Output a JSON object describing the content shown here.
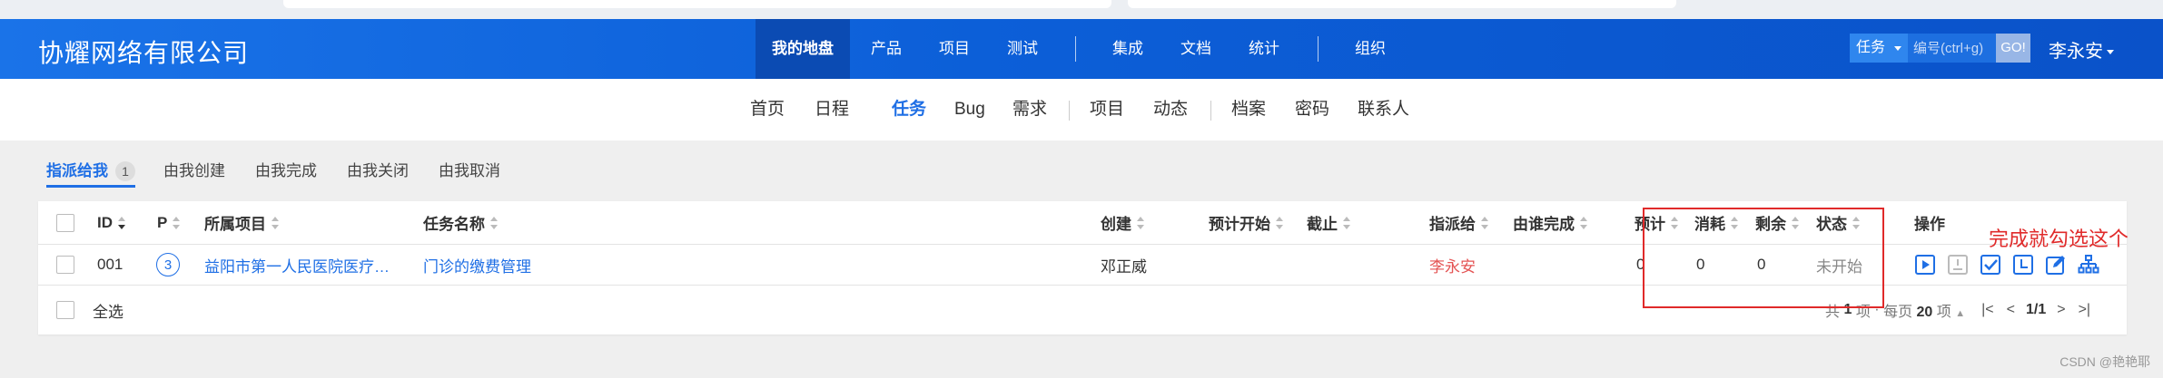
{
  "header": {
    "brand": "协耀网络有限公司",
    "nav": [
      "我的地盘",
      "产品",
      "项目",
      "测试",
      "集成",
      "文档",
      "统计",
      "组织"
    ],
    "active_nav": "我的地盘",
    "search": {
      "type_label": "任务",
      "placeholder": "编号(ctrl+g)",
      "go_label": "GO!"
    },
    "user": "李永安"
  },
  "subnav": {
    "items": [
      "首页",
      "日程",
      "任务",
      "Bug",
      "需求",
      "项目",
      "动态",
      "档案",
      "密码",
      "联系人"
    ],
    "active": "任务"
  },
  "filters": {
    "items": [
      "指派给我",
      "由我创建",
      "由我完成",
      "由我关闭",
      "由我取消"
    ],
    "active": "指派给我",
    "active_count": "1"
  },
  "table": {
    "headers": {
      "id": "ID",
      "pri": "P",
      "project": "所属项目",
      "name": "任务名称",
      "creator": "创建",
      "est_start": "预计开始",
      "deadline": "截止",
      "assigned": "指派给",
      "finished_by": "由谁完成",
      "estimate": "预计",
      "consumed": "消耗",
      "left": "剩余",
      "status": "状态",
      "actions": "操作"
    },
    "rows": [
      {
        "id": "001",
        "pri": "3",
        "project": "益阳市第一人民医院医疗…",
        "name": "门诊的缴费管理",
        "creator": "邓正威",
        "est_start": "",
        "deadline": "",
        "assigned": "李永安",
        "finished_by": "",
        "estimate": "0",
        "consumed": "0",
        "left": "0",
        "status": "未开始",
        "actions": [
          "start-icon",
          "pause-icon",
          "finish-icon",
          "record-hours-icon",
          "edit-icon",
          "subtask-icon"
        ]
      }
    ],
    "footer": {
      "select_all": "全选",
      "pager": {
        "total_prefix": "共",
        "total": "1",
        "total_suffix": "项",
        "per_prefix": "每页",
        "per": "20",
        "per_suffix": "项",
        "page": "1/1"
      }
    }
  },
  "annotation": {
    "text": "完成就勾选这个"
  },
  "watermark": "CSDN @艳艳耶",
  "colors": {
    "header": "#0c5fd8",
    "accent": "#1f6fe5",
    "annotation": "#e02a2a"
  }
}
